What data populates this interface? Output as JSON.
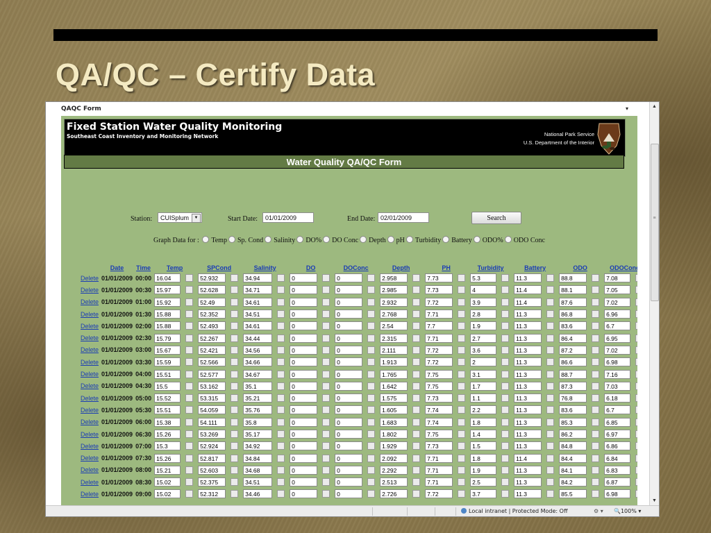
{
  "slide": {
    "title": "QA/QC – Certify Data"
  },
  "window": {
    "title": "QAQC Form",
    "dropdown_glyph": "▾"
  },
  "header": {
    "title": "Fixed Station Water Quality Monitoring",
    "subtitle": "Southeast Coast Inventory and Monitoring Network",
    "agency_line1": "National Park Service",
    "agency_line2": "U.S. Department of the Interior",
    "logo_icon": "nps-arrowhead-logo",
    "form_title": "Water Quality QA/QC Form"
  },
  "controls": {
    "station_label": "Station:",
    "station_value": "CUISplum",
    "start_label": "Start Date:",
    "start_value": "01/01/2009",
    "end_label": "End Date:",
    "end_value": "02/01/2009",
    "search_label": "Search",
    "graph_label": "Graph Data for :",
    "graph_options": [
      "Temp",
      "Sp. Cond",
      "Salinity",
      "DO%",
      "DO Conc",
      "Depth",
      "pH",
      "Turbidity",
      "Battery",
      "ODO%",
      "ODO Conc"
    ]
  },
  "table": {
    "headers": [
      "Date",
      "Time",
      "Temp",
      "SPCond",
      "Salinity",
      "DO",
      "DOConc",
      "Depth",
      "PH",
      "Turbidity",
      "Battery",
      "ODO",
      "ODOConc"
    ],
    "delete_label": "Delete",
    "rows": [
      {
        "date": "01/01/2009",
        "time": "00:00",
        "v": [
          "16.04",
          "52.932",
          "34.94",
          "0",
          "0",
          "2.958",
          "7.73",
          "5.3",
          "11.3",
          "88.8",
          "7.08"
        ]
      },
      {
        "date": "01/01/2009",
        "time": "00:30",
        "v": [
          "15.97",
          "52.628",
          "34.71",
          "0",
          "0",
          "2.985",
          "7.73",
          "4",
          "11.4",
          "88.1",
          "7.05"
        ]
      },
      {
        "date": "01/01/2009",
        "time": "01:00",
        "v": [
          "15.92",
          "52.49",
          "34.61",
          "0",
          "0",
          "2.932",
          "7.72",
          "3.9",
          "11.4",
          "87.6",
          "7.02"
        ]
      },
      {
        "date": "01/01/2009",
        "time": "01:30",
        "v": [
          "15.88",
          "52.352",
          "34.51",
          "0",
          "0",
          "2.768",
          "7.71",
          "2.8",
          "11.3",
          "86.8",
          "6.96"
        ]
      },
      {
        "date": "01/01/2009",
        "time": "02:00",
        "v": [
          "15.88",
          "52.493",
          "34.61",
          "0",
          "0",
          "2.54",
          "7.7",
          "1.9",
          "11.3",
          "83.6",
          "6.7"
        ]
      },
      {
        "date": "01/01/2009",
        "time": "02:30",
        "v": [
          "15.79",
          "52.267",
          "34.44",
          "0",
          "0",
          "2.315",
          "7.71",
          "2.7",
          "11.3",
          "86.4",
          "6.95"
        ]
      },
      {
        "date": "01/01/2009",
        "time": "03:00",
        "v": [
          "15.67",
          "52.421",
          "34.56",
          "0",
          "0",
          "2.111",
          "7.72",
          "3.6",
          "11.3",
          "87.2",
          "7.02"
        ]
      },
      {
        "date": "01/01/2009",
        "time": "03:30",
        "v": [
          "15.59",
          "52.566",
          "34.66",
          "0",
          "0",
          "1.913",
          "7.72",
          "2",
          "11.3",
          "86.6",
          "6.98"
        ]
      },
      {
        "date": "01/01/2009",
        "time": "04:00",
        "v": [
          "15.51",
          "52.577",
          "34.67",
          "0",
          "0",
          "1.765",
          "7.75",
          "3.1",
          "11.3",
          "88.7",
          "7.16"
        ]
      },
      {
        "date": "01/01/2009",
        "time": "04:30",
        "v": [
          "15.5",
          "53.162",
          "35.1",
          "0",
          "0",
          "1.642",
          "7.75",
          "1.7",
          "11.3",
          "87.3",
          "7.03"
        ]
      },
      {
        "date": "01/01/2009",
        "time": "05:00",
        "v": [
          "15.52",
          "53.315",
          "35.21",
          "0",
          "0",
          "1.575",
          "7.73",
          "1.1",
          "11.3",
          "76.8",
          "6.18"
        ]
      },
      {
        "date": "01/01/2009",
        "time": "05:30",
        "v": [
          "15.51",
          "54.059",
          "35.76",
          "0",
          "0",
          "1.605",
          "7.74",
          "2.2",
          "11.3",
          "83.6",
          "6.7"
        ]
      },
      {
        "date": "01/01/2009",
        "time": "06:00",
        "v": [
          "15.38",
          "54.111",
          "35.8",
          "0",
          "0",
          "1.683",
          "7.74",
          "1.8",
          "11.3",
          "85.3",
          "6.85"
        ]
      },
      {
        "date": "01/01/2009",
        "time": "06:30",
        "v": [
          "15.26",
          "53.269",
          "35.17",
          "0",
          "0",
          "1.802",
          "7.75",
          "1.4",
          "11.3",
          "86.2",
          "6.97"
        ]
      },
      {
        "date": "01/01/2009",
        "time": "07:00",
        "v": [
          "15.3",
          "52.924",
          "34.92",
          "0",
          "0",
          "1.929",
          "7.73",
          "1.5",
          "11.3",
          "84.8",
          "6.86"
        ]
      },
      {
        "date": "01/01/2009",
        "time": "07:30",
        "v": [
          "15.26",
          "52.817",
          "34.84",
          "0",
          "0",
          "2.092",
          "7.71",
          "1.8",
          "11.4",
          "84.4",
          "6.84"
        ]
      },
      {
        "date": "01/01/2009",
        "time": "08:00",
        "v": [
          "15.21",
          "52.603",
          "34.68",
          "0",
          "0",
          "2.292",
          "7.71",
          "1.9",
          "11.3",
          "84.1",
          "6.83"
        ]
      },
      {
        "date": "01/01/2009",
        "time": "08:30",
        "v": [
          "15.02",
          "52.375",
          "34.51",
          "0",
          "0",
          "2.513",
          "7.71",
          "2.5",
          "11.3",
          "84.2",
          "6.87"
        ]
      },
      {
        "date": "01/01/2009",
        "time": "09:00",
        "v": [
          "15.02",
          "52.312",
          "34.46",
          "0",
          "0",
          "2.726",
          "7.72",
          "3.7",
          "11.3",
          "85.5",
          "6.98"
        ]
      }
    ]
  },
  "statusbar": {
    "zone": "Local intranet | Protected Mode: Off",
    "zoom": "100%",
    "zoom_icon": "magnifier-icon",
    "zone_icon": "globe-icon"
  },
  "colors": {
    "form_background": "#9db97f",
    "subbar": "#637b45",
    "link": "#1a3cb5",
    "slide_title": "#f4eac2"
  }
}
